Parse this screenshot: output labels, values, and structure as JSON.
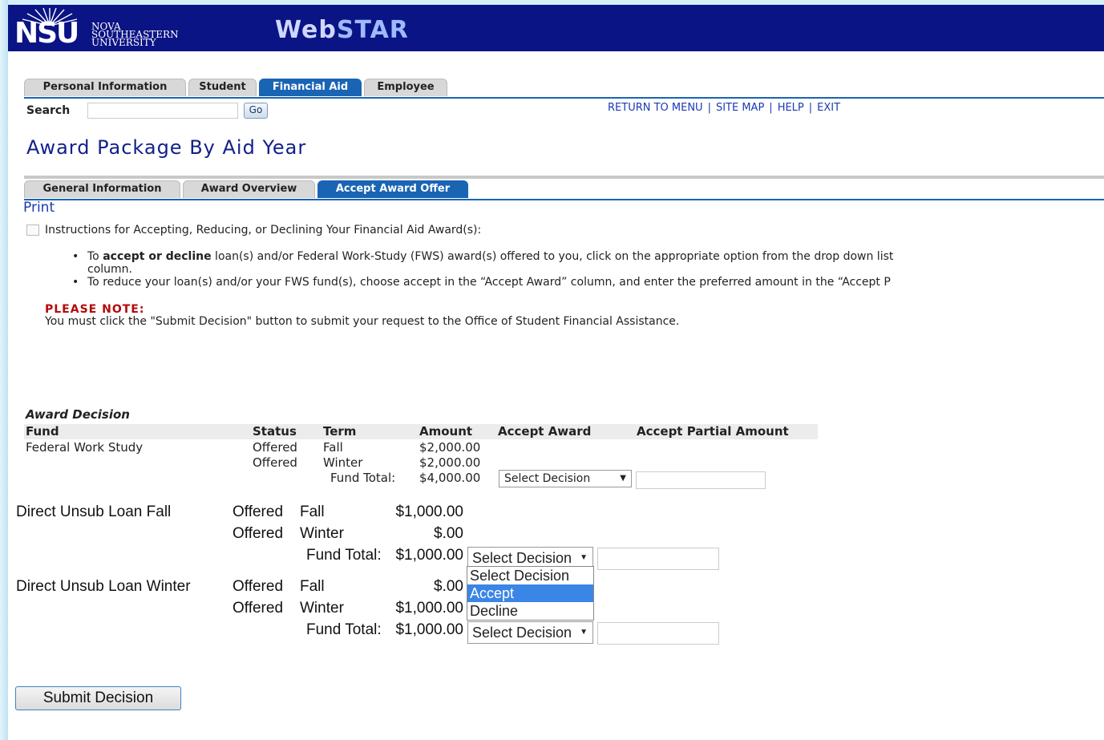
{
  "header": {
    "logo_text": "NSU",
    "university_lines": [
      "NOVA",
      "SOUTHEASTERN",
      "UNIVERSITY"
    ],
    "app_title_a": "Web",
    "app_title_b": "STAR"
  },
  "main_tabs": [
    {
      "label": "Personal Information",
      "active": false
    },
    {
      "label": "Student",
      "active": false
    },
    {
      "label": "Financial Aid",
      "active": true
    },
    {
      "label": "Employee",
      "active": false
    }
  ],
  "search": {
    "label": "Search",
    "value": "",
    "button_label": "Go"
  },
  "top_links": [
    "RETURN TO MENU",
    "SITE MAP",
    "HELP",
    "EXIT"
  ],
  "page_title": "Award Package By Aid Year",
  "sub_tabs": [
    {
      "label": "General Information",
      "active": false
    },
    {
      "label": "Award Overview",
      "active": false
    },
    {
      "label": "Accept Award Offer",
      "active": true
    }
  ],
  "print_label": "Print",
  "instructions": {
    "title": "Instructions for Accepting, Reducing, or Declining Your Financial Aid Award(s):",
    "bullet1_pre": "To ",
    "bullet1_bold": "accept or decline",
    "bullet1_post": " loan(s) and/or Federal Work-Study (FWS) award(s) offered to you, click on the appropriate option from the drop down list",
    "bullet1_cont": "column.",
    "bullet2": "To reduce your loan(s) and/or your FWS fund(s), choose accept in the “Accept Award” column, and enter the preferred amount in the “Accept P",
    "note_label": "PLEASE NOTE:",
    "note_text": "You must click the \"Submit Decision\" button to submit your request to the Office of Student Financial Assistance."
  },
  "award_decision": {
    "caption": "Award Decision",
    "headers": [
      "Fund",
      "Status",
      "Term",
      "Amount",
      "Accept Award",
      "Accept Partial Amount"
    ],
    "fund_total_label": "Fund Total:",
    "funds": [
      {
        "name": "Federal Work Study",
        "rows": [
          {
            "status": "Offered",
            "term": "Fall",
            "amount": "$2,000.00"
          },
          {
            "status": "Offered",
            "term": "Winter",
            "amount": "$2,000.00"
          }
        ],
        "total": "$4,000.00",
        "decision": "Select Decision"
      },
      {
        "name": "Direct Unsub Loan Fall",
        "rows": [
          {
            "status": "Offered",
            "term": "Fall",
            "amount": "$1,000.00"
          },
          {
            "status": "Offered",
            "term": "Winter",
            "amount": "$.00"
          }
        ],
        "total": "$1,000.00",
        "decision": "Select Decision"
      },
      {
        "name": "Direct Unsub Loan Winter",
        "rows": [
          {
            "status": "Offered",
            "term": "Fall",
            "amount": "$.00"
          },
          {
            "status": "Offered",
            "term": "Winter",
            "amount": "$1,000.00"
          }
        ],
        "total": "$1,000.00",
        "decision": "Select Decision"
      }
    ],
    "dropdown_options": [
      "Select Decision",
      "Accept",
      "Decline"
    ],
    "dropdown_highlighted": "Accept"
  },
  "submit_label": "Submit Decision"
}
